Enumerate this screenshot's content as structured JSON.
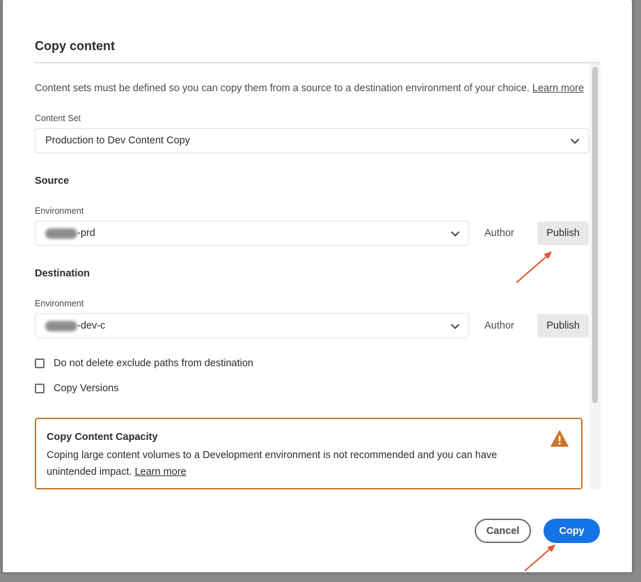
{
  "dialog": {
    "title": "Copy content",
    "intro": {
      "text": "Content sets must be defined so you can copy them from a source to a destination environment of your choice.",
      "link": "Learn more"
    },
    "content_set": {
      "label": "Content Set",
      "value": "Production to Dev Content Copy",
      "icon": "chevron-down-icon"
    },
    "source": {
      "section_title": "Source",
      "environment_label": "Environment",
      "environment_value_suffix": "-prd",
      "tiers": {
        "author": "Author",
        "publish": "Publish"
      }
    },
    "destination": {
      "section_title": "Destination",
      "environment_label": "Environment",
      "environment_value_suffix": "-dev-c",
      "tiers": {
        "author": "Author",
        "publish": "Publish"
      }
    },
    "options": {
      "exclude_paths": {
        "label": "Do not delete exclude paths from destination",
        "checked": false
      },
      "copy_versions": {
        "label": "Copy Versions",
        "checked": false
      }
    },
    "alert": {
      "title": "Copy Content Capacity",
      "body": "Coping large content volumes to a Development environment is not recommended and you can have unintended impact.",
      "link": "Learn more",
      "icon": "warning-icon",
      "border_color": "#c9752d"
    },
    "footer": {
      "cancel_label": "Cancel",
      "copy_label": "Copy",
      "accent_color": "#1473e6"
    },
    "annotation_color": "#e0552e"
  }
}
